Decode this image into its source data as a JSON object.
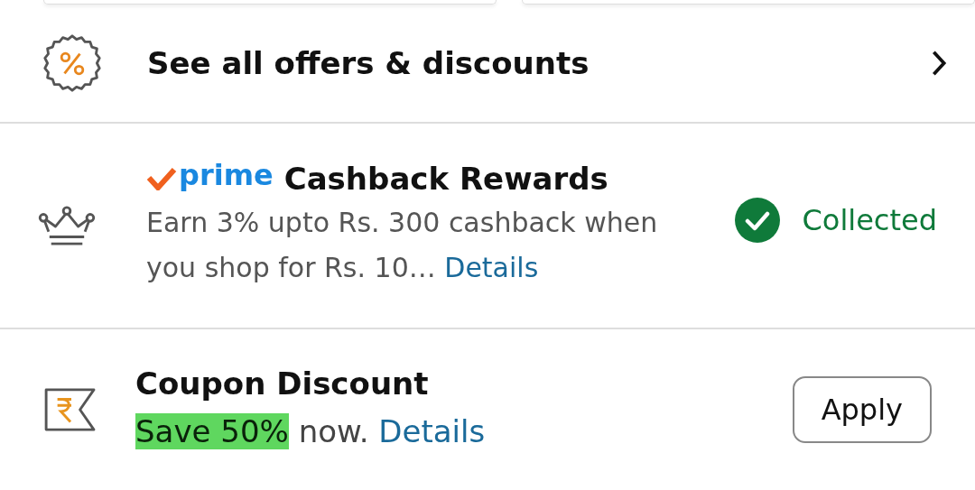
{
  "offers_link": {
    "label": "See all offers & discounts"
  },
  "offers": [
    {
      "kind": "cashback",
      "badge": "prime",
      "title": "Cashback Rewards",
      "description": "Earn 3% upto Rs. 300 cashback when you shop for Rs. 10…",
      "link": "Details",
      "status": "Collected",
      "collected": true
    },
    {
      "kind": "coupon",
      "title": "Coupon Discount",
      "highlight": "Save 50%",
      "description": "now.",
      "link": "Details",
      "button": "Apply"
    }
  ]
}
